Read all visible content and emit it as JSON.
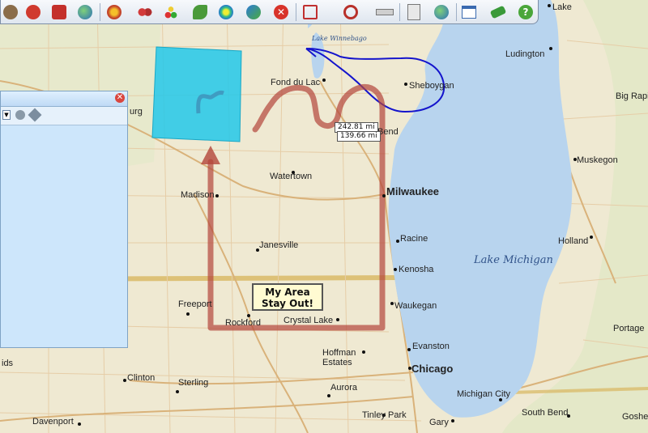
{
  "map": {
    "colors": {
      "land": "#efe9d2",
      "water": "#b8d4ee",
      "road": "#e3c9a1",
      "highway": "#d9b27a",
      "border": "#d2b45e",
      "route": "#b3453a",
      "cyan": "#22c8ea",
      "blue": "#1414cc"
    },
    "lakes": {
      "michigan": "Lake Michigan",
      "winnebago": "Lake Winnebago"
    },
    "labels": [
      {
        "id": "lake",
        "text": "Lake"
      },
      {
        "id": "ludington",
        "text": "Ludington"
      },
      {
        "id": "fond-du-lac",
        "text": "Fond du Lac"
      },
      {
        "id": "sheboygan",
        "text": "Sheboygan"
      },
      {
        "id": "big-rapids",
        "text": "Big Rapi"
      },
      {
        "id": "bend",
        "text": "Bend"
      },
      {
        "id": "muskegon",
        "text": "Muskegon"
      },
      {
        "id": "watertown",
        "text": "Watertown"
      },
      {
        "id": "madison",
        "text": "Madison"
      },
      {
        "id": "milwaukee",
        "text": "Milwaukee"
      },
      {
        "id": "janesville",
        "text": "Janesville"
      },
      {
        "id": "racine",
        "text": "Racine"
      },
      {
        "id": "holland",
        "text": "Holland"
      },
      {
        "id": "kenosha",
        "text": "Kenosha"
      },
      {
        "id": "freeport",
        "text": "Freeport"
      },
      {
        "id": "waukegan",
        "text": "Waukegan"
      },
      {
        "id": "rockford",
        "text": "Rockford"
      },
      {
        "id": "crystal-lake",
        "text": "Crystal Lake"
      },
      {
        "id": "portage",
        "text": "Portage"
      },
      {
        "id": "evanston",
        "text": "Evanston"
      },
      {
        "id": "hoffman-estates",
        "text": "Hoffman\nEstates"
      },
      {
        "id": "chicago",
        "text": "Chicago"
      },
      {
        "id": "clinton",
        "text": "Clinton"
      },
      {
        "id": "sterling",
        "text": "Sterling"
      },
      {
        "id": "aurora",
        "text": "Aurora"
      },
      {
        "id": "michigan-city",
        "text": "Michigan City"
      },
      {
        "id": "davenport",
        "text": "Davenport"
      },
      {
        "id": "tinley-park",
        "text": "Tinley Park"
      },
      {
        "id": "south-bend",
        "text": "South Bend"
      },
      {
        "id": "gary",
        "text": "Gary"
      },
      {
        "id": "goshen",
        "text": "Goshe"
      },
      {
        "id": "burg",
        "text": "urg"
      },
      {
        "id": "ids",
        "text": "ids"
      }
    ],
    "callout": {
      "line1": "My Area",
      "line2": "Stay Out!"
    },
    "measure": {
      "distance": "242.81 mi",
      "distance2": "139.66 mi"
    }
  },
  "toolbar": {
    "icons": [
      "person-icon",
      "add-pin-icon",
      "puzzle-icon",
      "globe-icon",
      "target-icon",
      "circles-icon",
      "multi-dot-icon",
      "leaf-icon",
      "radar-icon",
      "cluster-icon",
      "delete-icon",
      "route-icon",
      "polygon-icon",
      "ruler-icon",
      "document-icon",
      "save-globe-icon",
      "calendar-icon",
      "eraser-icon",
      "help-icon"
    ]
  },
  "panel": {
    "close": "✕"
  }
}
